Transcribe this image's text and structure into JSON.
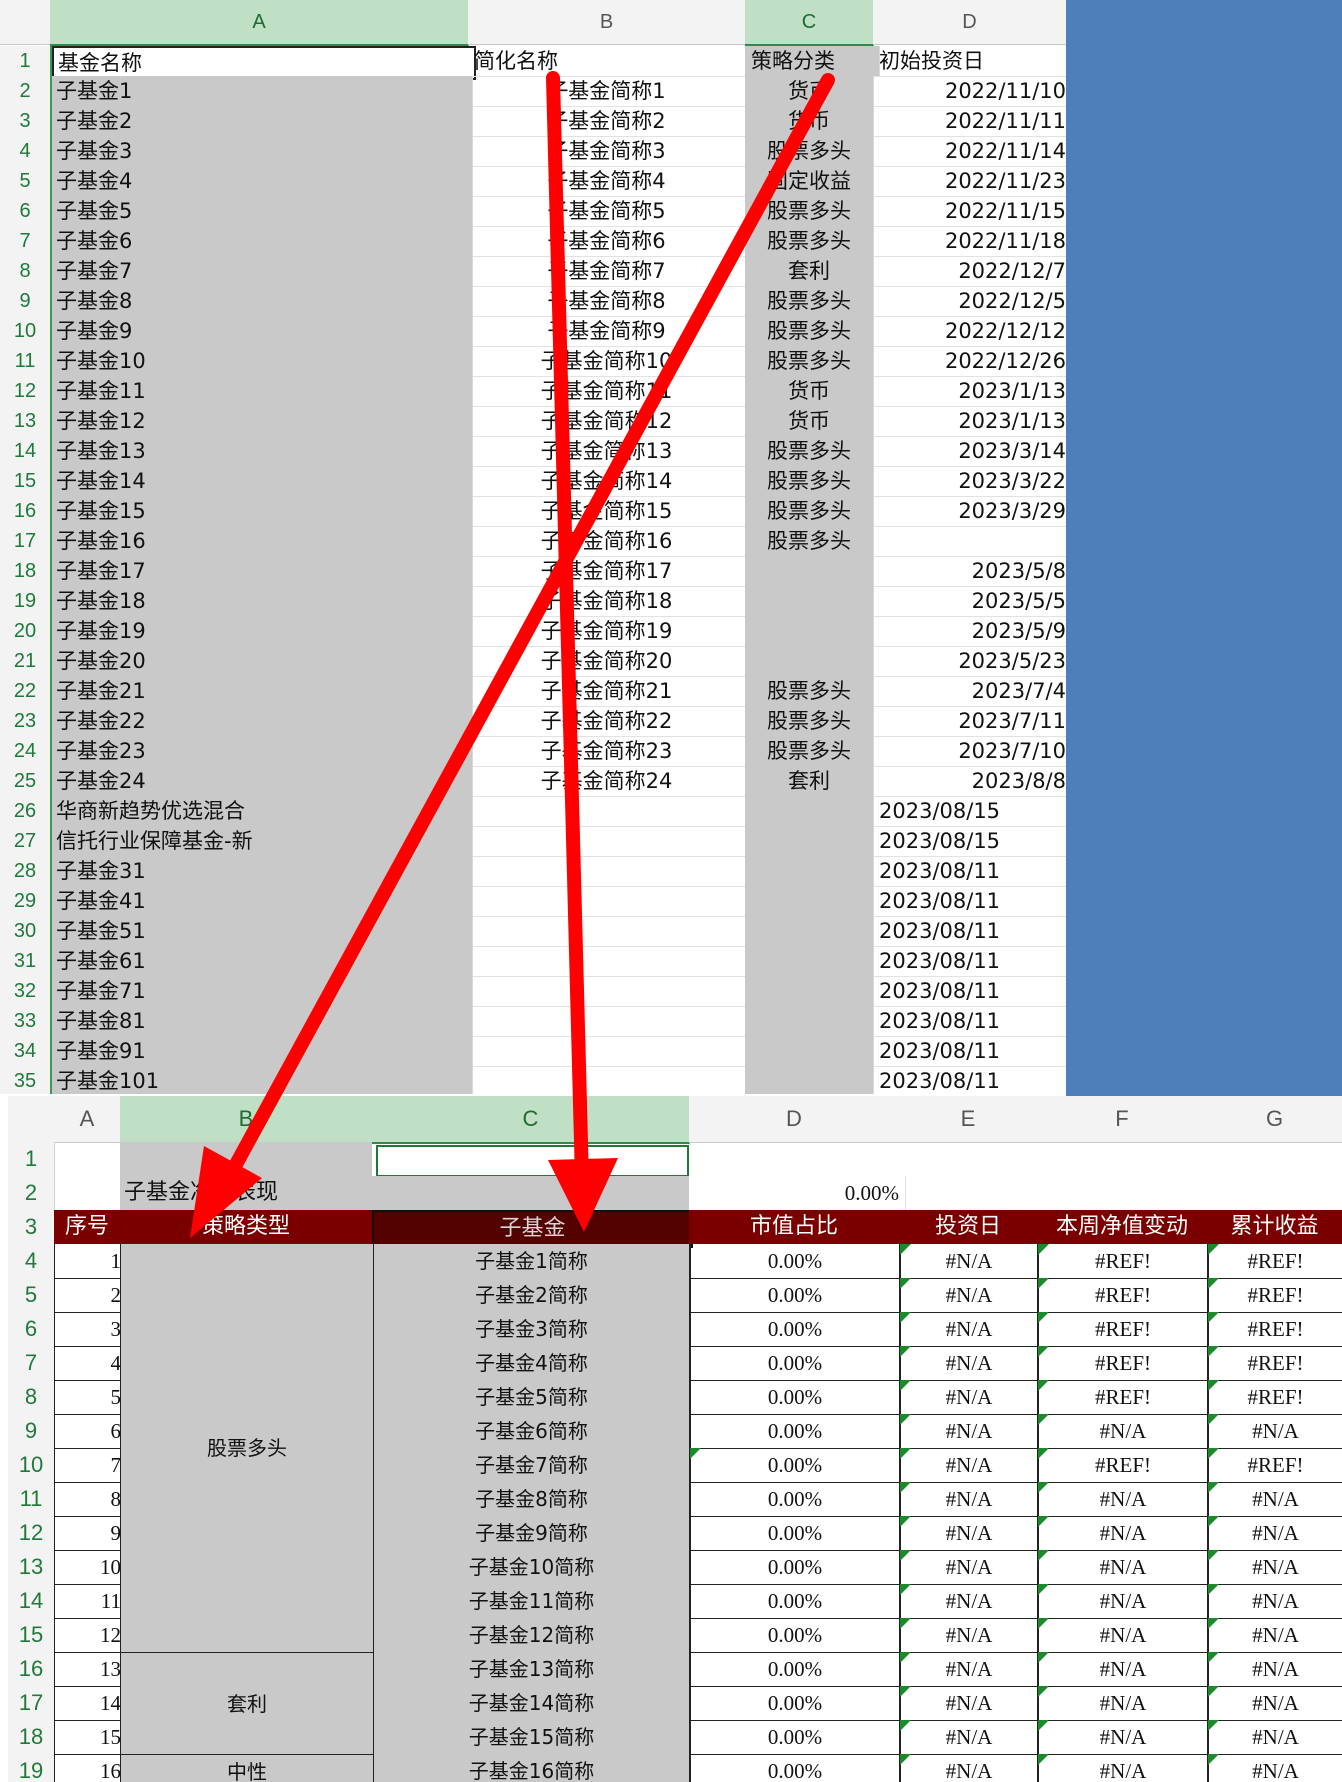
{
  "upper": {
    "columns": [
      "A",
      "B",
      "C",
      "D"
    ],
    "header": {
      "name": "基金名称",
      "short": "简化名称",
      "strategy": "策略分类",
      "date": "初始投资日"
    },
    "rows": [
      {
        "n": "2",
        "name": "子基金1",
        "short": "子基金简称1",
        "strategy": "货币",
        "date": "2022/11/10"
      },
      {
        "n": "3",
        "name": "子基金2",
        "short": "子基金简称2",
        "strategy": "货币",
        "date": "2022/11/11"
      },
      {
        "n": "4",
        "name": "子基金3",
        "short": "子基金简称3",
        "strategy": "股票多头",
        "date": "2022/11/14"
      },
      {
        "n": "5",
        "name": "子基金4",
        "short": "子基金简称4",
        "strategy": "固定收益",
        "date": "2022/11/23"
      },
      {
        "n": "6",
        "name": "子基金5",
        "short": "子基金简称5",
        "strategy": "股票多头",
        "date": "2022/11/15"
      },
      {
        "n": "7",
        "name": "子基金6",
        "short": "子基金简称6",
        "strategy": "股票多头",
        "date": "2022/11/18"
      },
      {
        "n": "8",
        "name": "子基金7",
        "short": "子基金简称7",
        "strategy": "套利",
        "date": "2022/12/7"
      },
      {
        "n": "9",
        "name": "子基金8",
        "short": "子基金简称8",
        "strategy": "股票多头",
        "date": "2022/12/5"
      },
      {
        "n": "10",
        "name": "子基金9",
        "short": "子基金简称9",
        "strategy": "股票多头",
        "date": "2022/12/12"
      },
      {
        "n": "11",
        "name": "子基金10",
        "short": "子基金简称10",
        "strategy": "股票多头",
        "date": "2022/12/26"
      },
      {
        "n": "12",
        "name": "子基金11",
        "short": "子基金简称11",
        "strategy": "货币",
        "date": "2023/1/13"
      },
      {
        "n": "13",
        "name": "子基金12",
        "short": "子基金简称12",
        "strategy": "货币",
        "date": "2023/1/13"
      },
      {
        "n": "14",
        "name": "子基金13",
        "short": "子基金简称13",
        "strategy": "股票多头",
        "date": "2023/3/14"
      },
      {
        "n": "15",
        "name": "子基金14",
        "short": "子基金简称14",
        "strategy": "股票多头",
        "date": "2023/3/22"
      },
      {
        "n": "16",
        "name": "子基金15",
        "short": "子基金简称15",
        "strategy": "股票多头",
        "date": "2023/3/29"
      },
      {
        "n": "17",
        "name": "子基金16",
        "short": "子基金简称16",
        "strategy": "股票多头",
        "date": ""
      },
      {
        "n": "18",
        "name": "子基金17",
        "short": "子基金简称17",
        "strategy": "",
        "date": "2023/5/8"
      },
      {
        "n": "19",
        "name": "子基金18",
        "short": "子基金简称18",
        "strategy": "",
        "date": "2023/5/5"
      },
      {
        "n": "20",
        "name": "子基金19",
        "short": "子基金简称19",
        "strategy": "",
        "date": "2023/5/9"
      },
      {
        "n": "21",
        "name": "子基金20",
        "short": "子基金简称20",
        "strategy": "",
        "date": "2023/5/23"
      },
      {
        "n": "22",
        "name": "子基金21",
        "short": "子基金简称21",
        "strategy": "股票多头",
        "date": "2023/7/4"
      },
      {
        "n": "23",
        "name": "子基金22",
        "short": "子基金简称22",
        "strategy": "股票多头",
        "date": "2023/7/11"
      },
      {
        "n": "24",
        "name": "子基金23",
        "short": "子基金简称23",
        "strategy": "股票多头",
        "date": "2023/7/10"
      },
      {
        "n": "25",
        "name": "子基金24",
        "short": "子基金简称24",
        "strategy": "套利",
        "date": "2023/8/8"
      },
      {
        "n": "26",
        "name": "华商新趋势优选混合",
        "short": "",
        "strategy": "",
        "date": "2023/08/15"
      },
      {
        "n": "27",
        "name": "信托行业保障基金-新",
        "short": "",
        "strategy": "",
        "date": "2023/08/15"
      },
      {
        "n": "28",
        "name": "子基金31",
        "short": "",
        "strategy": "",
        "date": "2023/08/11"
      },
      {
        "n": "29",
        "name": "子基金41",
        "short": "",
        "strategy": "",
        "date": "2023/08/11"
      },
      {
        "n": "30",
        "name": "子基金51",
        "short": "",
        "strategy": "",
        "date": "2023/08/11"
      },
      {
        "n": "31",
        "name": "子基金61",
        "short": "",
        "strategy": "",
        "date": "2023/08/11"
      },
      {
        "n": "32",
        "name": "子基金71",
        "short": "",
        "strategy": "",
        "date": "2023/08/11"
      },
      {
        "n": "33",
        "name": "子基金81",
        "short": "",
        "strategy": "",
        "date": "2023/08/11"
      },
      {
        "n": "34",
        "name": "子基金91",
        "short": "",
        "strategy": "",
        "date": "2023/08/11"
      },
      {
        "n": "35",
        "name": "子基金101",
        "short": "",
        "strategy": "",
        "date": "2023/08/11"
      }
    ]
  },
  "lower": {
    "columns": [
      "A",
      "B",
      "C",
      "D",
      "E",
      "F",
      "G"
    ],
    "title": "子基金净值表现",
    "total_pct": "0.00%",
    "headers": {
      "seq": "序号",
      "strategy": "策略类型",
      "fund": "子基金",
      "weight": "市值占比",
      "date": "投资日",
      "week": "本周净值变动",
      "cum": "累计收益"
    },
    "groups": [
      {
        "label": "股票多头"
      },
      {
        "label": "套利"
      },
      {
        "label": "中性"
      }
    ],
    "rows": [
      {
        "r": "4",
        "seq": "1",
        "fund": "子基金1简称",
        "weight": "0.00%",
        "date": "#N/A",
        "week": "#REF!",
        "cum": "#REF!"
      },
      {
        "r": "5",
        "seq": "2",
        "fund": "子基金2简称",
        "weight": "0.00%",
        "date": "#N/A",
        "week": "#REF!",
        "cum": "#REF!"
      },
      {
        "r": "6",
        "seq": "3",
        "fund": "子基金3简称",
        "weight": "0.00%",
        "date": "#N/A",
        "week": "#REF!",
        "cum": "#REF!"
      },
      {
        "r": "7",
        "seq": "4",
        "fund": "子基金4简称",
        "weight": "0.00%",
        "date": "#N/A",
        "week": "#REF!",
        "cum": "#REF!"
      },
      {
        "r": "8",
        "seq": "5",
        "fund": "子基金5简称",
        "weight": "0.00%",
        "date": "#N/A",
        "week": "#REF!",
        "cum": "#REF!"
      },
      {
        "r": "9",
        "seq": "6",
        "fund": "子基金6简称",
        "weight": "0.00%",
        "date": "#N/A",
        "week": "#N/A",
        "cum": "#N/A"
      },
      {
        "r": "10",
        "seq": "7",
        "fund": "子基金7简称",
        "weight": "0.00%",
        "date": "#N/A",
        "week": "#REF!",
        "cum": "#REF!"
      },
      {
        "r": "11",
        "seq": "8",
        "fund": "子基金8简称",
        "weight": "0.00%",
        "date": "#N/A",
        "week": "#N/A",
        "cum": "#N/A"
      },
      {
        "r": "12",
        "seq": "9",
        "fund": "子基金9简称",
        "weight": "0.00%",
        "date": "#N/A",
        "week": "#N/A",
        "cum": "#N/A"
      },
      {
        "r": "13",
        "seq": "10",
        "fund": "子基金10简称",
        "weight": "0.00%",
        "date": "#N/A",
        "week": "#N/A",
        "cum": "#N/A"
      },
      {
        "r": "14",
        "seq": "11",
        "fund": "子基金11简称",
        "weight": "0.00%",
        "date": "#N/A",
        "week": "#N/A",
        "cum": "#N/A"
      },
      {
        "r": "15",
        "seq": "12",
        "fund": "子基金12简称",
        "weight": "0.00%",
        "date": "#N/A",
        "week": "#N/A",
        "cum": "#N/A"
      },
      {
        "r": "16",
        "seq": "13",
        "fund": "子基金13简称",
        "weight": "0.00%",
        "date": "#N/A",
        "week": "#N/A",
        "cum": "#N/A"
      },
      {
        "r": "17",
        "seq": "14",
        "fund": "子基金14简称",
        "weight": "0.00%",
        "date": "#N/A",
        "week": "#N/A",
        "cum": "#N/A"
      },
      {
        "r": "18",
        "seq": "15",
        "fund": "子基金15简称",
        "weight": "0.00%",
        "date": "#N/A",
        "week": "#N/A",
        "cum": "#N/A"
      },
      {
        "r": "19",
        "seq": "16",
        "fund": "子基金16简称",
        "weight": "0.00%",
        "date": "#N/A",
        "week": "#N/A",
        "cum": "#N/A"
      }
    ],
    "row_labels_top": [
      "1",
      "2",
      "3"
    ]
  },
  "colors": {
    "arrow": "#ff0000",
    "header_red": "#7a0000",
    "header_dark": "#520000",
    "cell_gray": "#c9c9c9",
    "sheet_blue": "#4e7fbb"
  }
}
